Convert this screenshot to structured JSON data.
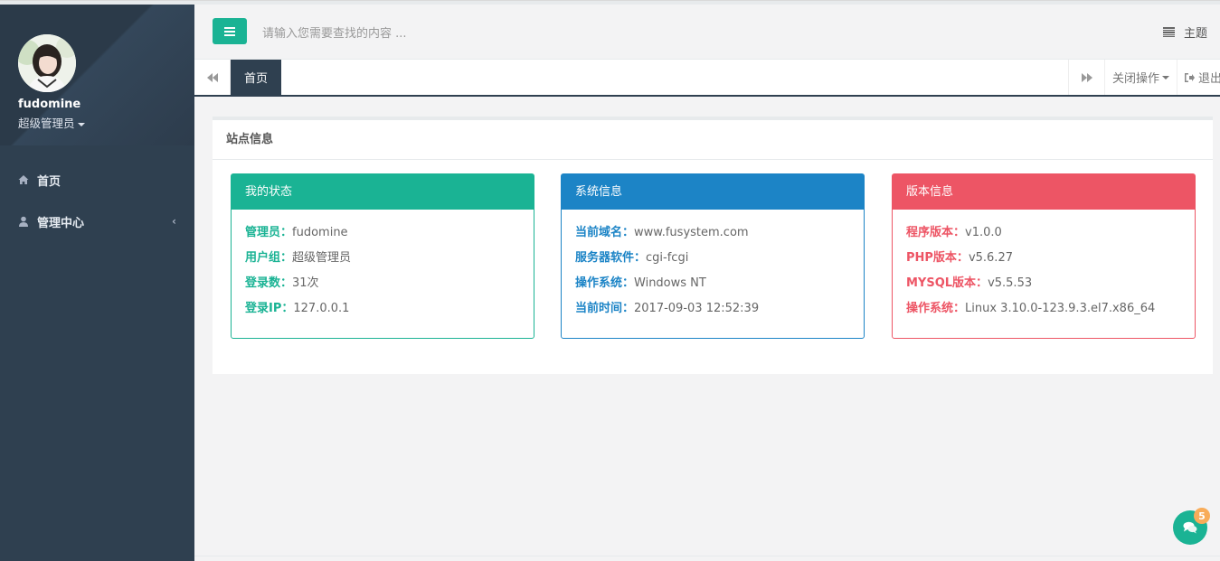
{
  "sidebar": {
    "user_name": "fudomine",
    "user_role": "超级管理员",
    "items": [
      {
        "label": "首页",
        "icon": "home-icon"
      },
      {
        "label": "管理中心",
        "icon": "user-icon"
      }
    ]
  },
  "header": {
    "search_placeholder": "请输入您需要查找的内容 ...",
    "theme_label": "主题"
  },
  "tabs": {
    "active": "首页",
    "close_ops": "关闭操作",
    "logout": "退出"
  },
  "panel": {
    "title": "站点信息",
    "status": {
      "title": "我的状态",
      "rows": [
        {
          "k": "管理员：",
          "v": "fudomine"
        },
        {
          "k": "用户组：",
          "v": "超级管理员"
        },
        {
          "k": "登录数：",
          "v": "31次"
        },
        {
          "k": "登录IP：",
          "v": "127.0.0.1"
        }
      ]
    },
    "system": {
      "title": "系统信息",
      "rows": [
        {
          "k": "当前域名：",
          "v": "www.fusystem.com"
        },
        {
          "k": "服务器软件：",
          "v": "cgi-fcgi"
        },
        {
          "k": "操作系统：",
          "v": "Windows NT"
        },
        {
          "k": "当前时间：",
          "v": "2017-09-03 12:52:39"
        }
      ]
    },
    "version": {
      "title": "版本信息",
      "rows": [
        {
          "k": "程序版本：",
          "v": "v1.0.0"
        },
        {
          "k": "PHP版本：",
          "v": "v5.6.27"
        },
        {
          "k": "MYSQL版本：",
          "v": "v5.5.53"
        },
        {
          "k": "操作系统：",
          "v": "Linux 3.10.0-123.9.3.el7.x86_64"
        }
      ]
    }
  },
  "chat": {
    "badge": "5"
  },
  "colors": {
    "sidebar": "#2f4050",
    "primary": "#1ab394",
    "info": "#1c84c6",
    "danger": "#ed5565",
    "warning": "#f8ac59"
  }
}
